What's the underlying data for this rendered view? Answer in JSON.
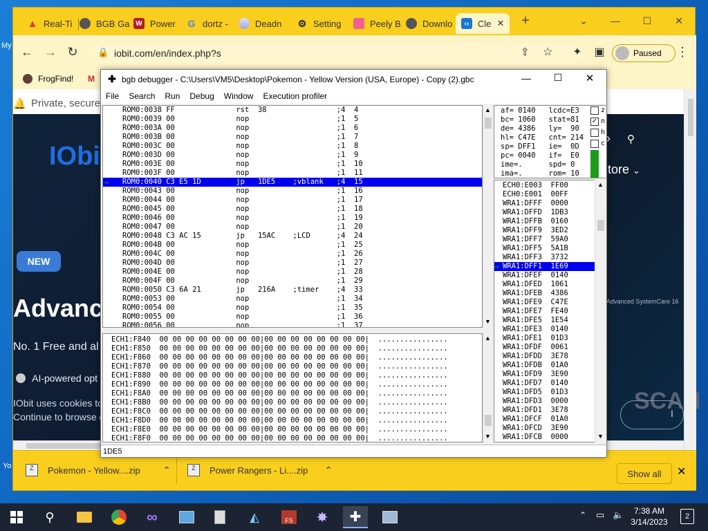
{
  "desktop": {
    "left_labels": [
      "My",
      "Yo"
    ]
  },
  "chrome": {
    "tabs": [
      {
        "label": "Real-Ti",
        "icon": "warning-icon"
      },
      {
        "label": "BGB Ga",
        "icon": "globe-icon"
      },
      {
        "label": "Power",
        "icon": "w-icon"
      },
      {
        "label": "dortz -",
        "icon": "google-icon"
      },
      {
        "label": "Deadn",
        "icon": "disc-icon"
      },
      {
        "label": "Setting",
        "icon": "gear-icon"
      },
      {
        "label": "Peely B",
        "icon": "page-icon"
      },
      {
        "label": "Downlo",
        "icon": "globe-icon"
      },
      {
        "label": "Cle",
        "icon": "code-icon"
      }
    ],
    "url": "iobit.com/en/index.php?s",
    "profile_label": "Paused",
    "bookmarks": [
      "FrogFind!",
      "M"
    ],
    "page": {
      "private_text": "Private, secure",
      "logo": "IObi",
      "store_text": "tore",
      "new_badge": "NEW",
      "advance_heading": "Advance",
      "free_text": "No. 1 Free and al",
      "ai_text": "AI-powered opt",
      "cookie_line1": "IObit uses cookies to",
      "cookie_line2": "Continue to browse o",
      "sc_label": "Advanced SystemCare 16",
      "scan_text": "SCAN",
      "scan_btn": "I"
    },
    "downloads": [
      {
        "name": "Pokemon - Yellow....zip"
      },
      {
        "name": "Power Rangers - Li....zip"
      }
    ],
    "show_all": "Show all"
  },
  "bgb": {
    "title": "bgb debugger - C:\\Users\\VM5\\Desktop\\Pokemon - Yellow Version (USA, Europe) - Copy (2).gbc",
    "menu": [
      "File",
      "Search",
      "Run",
      "Debug",
      "Window",
      "Execution profiler"
    ],
    "disasm": [
      {
        "text": "ROM0:0038 FF              rst  38                ;4  4",
        "hl": false
      },
      {
        "text": "ROM0:0039 00              nop                    ;1  5",
        "hl": false
      },
      {
        "text": "ROM0:003A 00              nop                    ;1  6",
        "hl": false
      },
      {
        "text": "ROM0:003B 00              nop                    ;1  7",
        "hl": false
      },
      {
        "text": "ROM0:003C 00              nop                    ;1  8",
        "hl": false
      },
      {
        "text": "ROM0:003D 00              nop                    ;1  9",
        "hl": false
      },
      {
        "text": "ROM0:003E 00              nop                    ;1  10",
        "hl": false
      },
      {
        "text": "ROM0:003F 00              nop                    ;1  11",
        "hl": false
      },
      {
        "text": "ROM0:0040 C3 E5 1D        jp   1DE5    ;vblank   ;4  15",
        "hl": true
      },
      {
        "text": "ROM0:0043 00              nop                    ;1  16",
        "hl": false
      },
      {
        "text": "ROM0:0044 00              nop                    ;1  17",
        "hl": false
      },
      {
        "text": "ROM0:0045 00              nop                    ;1  18",
        "hl": false
      },
      {
        "text": "ROM0:0046 00              nop                    ;1  19",
        "hl": false
      },
      {
        "text": "ROM0:0047 00              nop                    ;1  20",
        "hl": false
      },
      {
        "text": "ROM0:0048 C3 AC 15        jp   15AC    ;LCD      ;4  24",
        "hl": false
      },
      {
        "text": "ROM0:004B 00              nop                    ;1  25",
        "hl": false
      },
      {
        "text": "ROM0:004C 00              nop                    ;1  26",
        "hl": false
      },
      {
        "text": "ROM0:004D 00              nop                    ;1  27",
        "hl": false
      },
      {
        "text": "ROM0:004E 00              nop                    ;1  28",
        "hl": false
      },
      {
        "text": "ROM0:004F 00              nop                    ;1  29",
        "hl": false
      },
      {
        "text": "ROM0:0050 C3 6A 21        jp   216A    ;timer    ;4  33",
        "hl": false
      },
      {
        "text": "ROM0:0053 00              nop                    ;1  34",
        "hl": false
      },
      {
        "text": "ROM0:0054 00              nop                    ;1  35",
        "hl": false
      },
      {
        "text": "ROM0:0055 00              nop                    ;1  36",
        "hl": false
      },
      {
        "text": "ROM0:0056 00              nop                    ;1  37",
        "hl": false
      }
    ],
    "hex": [
      "ECH1:F840  00 00 00 00 00 00 00 00|00 00 00 00 00 00 00 00|  ................",
      "ECH1:F850  00 00 00 00 00 00 00 00|00 00 00 00 00 00 00 00|  ................",
      "ECH1:F860  00 00 00 00 00 00 00 00|00 00 00 00 00 00 00 00|  ................",
      "ECH1:F870  00 00 00 00 00 00 00 00|00 00 00 00 00 00 00 00|  ................",
      "ECH1:F880  00 00 00 00 00 00 00 00|00 00 00 00 00 00 00 00|  ................",
      "ECH1:F890  00 00 00 00 00 00 00 00|00 00 00 00 00 00 00 00|  ................",
      "ECH1:F8A0  00 00 00 00 00 00 00 00|00 00 00 00 00 00 00 00|  ................",
      "ECH1:F8B0  00 00 00 00 00 00 00 00|00 00 00 00 00 00 00 00|  ................",
      "ECH1:F8C0  00 00 00 00 00 00 00 00|00 00 00 00 00 00 00 00|  ................",
      "ECH1:F8D0  00 00 00 00 00 00 00 00|00 00 00 00 00 00 00 00|  ................",
      "ECH1:F8E0  00 00 00 00 00 00 00 00|00 00 00 00 00 00 00 00|  ................",
      "ECH1:F8F0  00 00 00 00 00 00 00 00|00 00 00 00 00 00 00 00|  ................"
    ],
    "registers": [
      "af= 0140   lcdc=E3",
      "bc= 1060   stat=81",
      "de= 4386   ly=  90",
      "hl= C47E   cnt= 214",
      "sp= DFF1   ie=  0D",
      "pc= 0040   if=  E0",
      "ime=.      spd= 0",
      "ima=.      rom= 10"
    ],
    "flags": [
      {
        "label": "z",
        "checked": false
      },
      {
        "label": "n",
        "checked": true
      },
      {
        "label": "h",
        "checked": false
      },
      {
        "label": "c",
        "checked": false
      }
    ],
    "stack": [
      {
        "text": "ECH0:E003  FF00",
        "hl": false
      },
      {
        "text": "ECH0:E001  00FF",
        "hl": false
      },
      {
        "text": "WRA1:DFFF  0000",
        "hl": false
      },
      {
        "text": "WRA1:DFFD  1DB3",
        "hl": false
      },
      {
        "text": "WRA1:DFFB  0160",
        "hl": false
      },
      {
        "text": "WRA1:DFF9  3ED2",
        "hl": false
      },
      {
        "text": "WRA1:DFF7  59A0",
        "hl": false
      },
      {
        "text": "WRA1:DFF5  5A1B",
        "hl": false
      },
      {
        "text": "WRA1:DFF3  3732",
        "hl": false
      },
      {
        "text": "WRA1:DFF1  1E69",
        "hl": true
      },
      {
        "text": "WRA1:DFEF  0140",
        "hl": false
      },
      {
        "text": "WRA1:DFED  1061",
        "hl": false
      },
      {
        "text": "WRA1:DFEB  4386",
        "hl": false
      },
      {
        "text": "WRA1:DFE9  C47E",
        "hl": false
      },
      {
        "text": "WRA1:DFE7  FE40",
        "hl": false
      },
      {
        "text": "WRA1:DFE5  1E54",
        "hl": false
      },
      {
        "text": "WRA1:DFE3  0140",
        "hl": false
      },
      {
        "text": "WRA1:DFE1  01D3",
        "hl": false
      },
      {
        "text": "WRA1:DFDF  0061",
        "hl": false
      },
      {
        "text": "WRA1:DFDD  3E78",
        "hl": false
      },
      {
        "text": "WRA1:DFDB  01A0",
        "hl": false
      },
      {
        "text": "WRA1:DFD9  3E90",
        "hl": false
      },
      {
        "text": "WRA1:DFD7  0140",
        "hl": false
      },
      {
        "text": "WRA1:DFD5  01D3",
        "hl": false
      },
      {
        "text": "WRA1:DFD3  0000",
        "hl": false
      },
      {
        "text": "WRA1:DFD1  3E78",
        "hl": false
      },
      {
        "text": "WRA1:DFCF  01A0",
        "hl": false
      },
      {
        "text": "WRA1:DFCD  3E90",
        "hl": false
      },
      {
        "text": "WRA1:DFCB  0000",
        "hl": false
      }
    ],
    "status": "1DE5"
  },
  "taskbar": {
    "time": "7:38 AM",
    "date": "3/14/2023",
    "notification_count": "2",
    "apps": [
      "start-icon",
      "search-icon",
      "file-explorer-icon",
      "chrome-icon",
      "visual-studio-icon",
      "control-panel-icon",
      "notepad-icon",
      "affinity-icon",
      "fs-icon",
      "game-icon",
      "bgb-icon",
      "network-tool-icon"
    ]
  }
}
